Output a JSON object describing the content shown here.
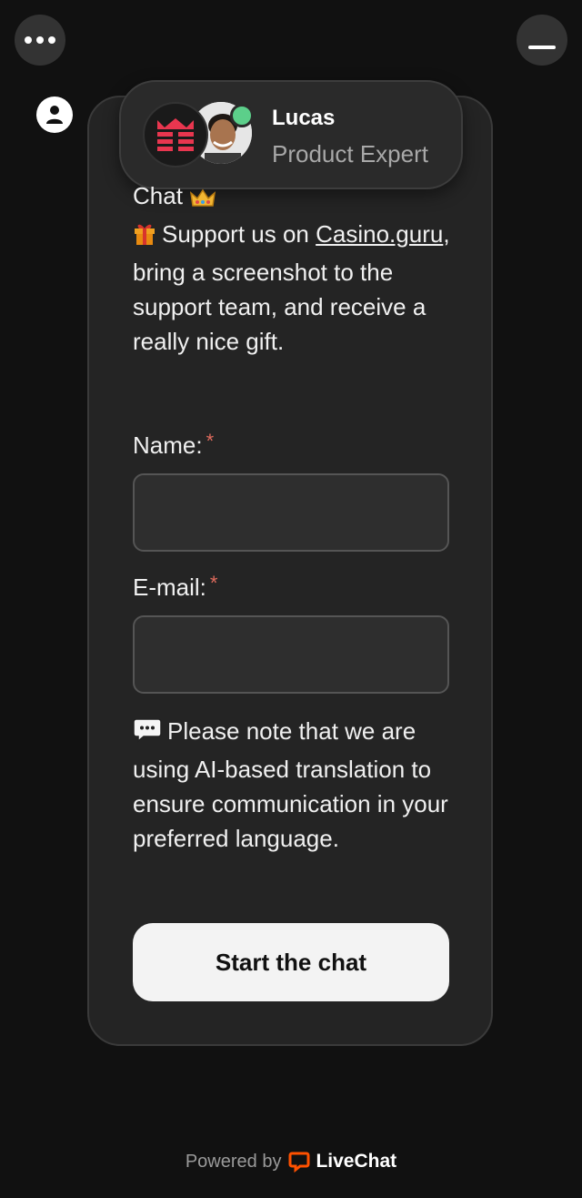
{
  "header": {
    "menu_icon": "more-horizontal-icon",
    "minimize_icon": "minimize-icon",
    "user_icon": "user-icon"
  },
  "agent": {
    "name": "Lucas",
    "role": "Product Expert",
    "status": "online",
    "status_color": "#5ccf8a",
    "logo_color": "#e8364f"
  },
  "welcome": {
    "line1": "Chat",
    "line1_emoji": "crown-icon",
    "gift_emoji": "gift-icon",
    "text_before_link": "Support us on ",
    "link_text": "Casino.guru",
    "text_after_link": ", bring a screenshot to the support team, and receive a really nice gift."
  },
  "form": {
    "name_label": "Name:",
    "name_required": "*",
    "name_value": "",
    "email_label": "E-mail:",
    "email_required": "*",
    "email_value": ""
  },
  "notice": {
    "icon": "speech-bubble-icon",
    "text": "Please note that we are using AI-based translation to ensure communication in your preferred language."
  },
  "actions": {
    "start_label": "Start the chat"
  },
  "footer": {
    "powered_by": "Powered by",
    "brand": "LiveChat",
    "brand_color": "#ff5100"
  }
}
